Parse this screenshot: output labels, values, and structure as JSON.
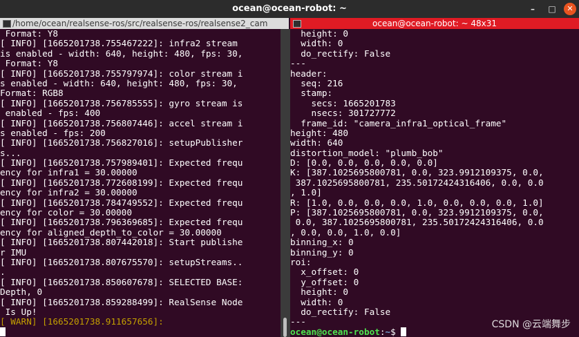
{
  "window": {
    "title": "ocean@ocean-robot: ~",
    "minimize": "–",
    "maximize": "□",
    "close": "✕"
  },
  "tabs": [
    {
      "title": "/home/ocean/realsense-ros/src/realsense-ros/realsense2_cam"
    },
    {
      "title": "ocean@ocean-robot: ~ 48x31"
    }
  ],
  "left_terminal": {
    "lines": [
      " Format: Y8",
      "[ INFO] [1665201738.755467222]: infra2 stream",
      "is enabled - width: 640, height: 480, fps: 30,",
      " Format: Y8",
      "[ INFO] [1665201738.755797974]: color stream i",
      "s enabled - width: 640, height: 480, fps: 30,",
      "Format: RGB8",
      "[ INFO] [1665201738.756785555]: gyro stream is",
      " enabled - fps: 400",
      "[ INFO] [1665201738.756807446]: accel stream i",
      "s enabled - fps: 200",
      "[ INFO] [1665201738.756827016]: setupPublisher",
      "s...",
      "[ INFO] [1665201738.757989401]: Expected frequ",
      "ency for infra1 = 30.00000",
      "[ INFO] [1665201738.772608199]: Expected frequ",
      "ency for infra2 = 30.00000",
      "[ INFO] [1665201738.784749552]: Expected frequ",
      "ency for color = 30.00000",
      "[ INFO] [1665201738.796369685]: Expected frequ",
      "ency for aligned_depth_to_color = 30.00000",
      "[ INFO] [1665201738.807442018]: Start publishe",
      "r IMU",
      "[ INFO] [1665201738.807675570]: setupStreams..",
      ".",
      "[ INFO] [1665201738.850607678]: SELECTED BASE:",
      "Depth, 0",
      "[ INFO] [1665201738.859288499]: RealSense Node",
      " Is Up!"
    ],
    "warn_line": "[ WARN] [1665201738.911657656]:"
  },
  "right_terminal": {
    "lines": [
      "  height: 0",
      "  width: 0",
      "  do_rectify: False",
      "---",
      "header:",
      "  seq: 216",
      "  stamp:",
      "    secs: 1665201783",
      "    nsecs: 301727772",
      "  frame_id: \"camera_infra1_optical_frame\"",
      "height: 480",
      "width: 640",
      "distortion_model: \"plumb_bob\"",
      "D: [0.0, 0.0, 0.0, 0.0, 0.0]",
      "K: [387.1025695800781, 0.0, 323.9912109375, 0.0,",
      " 387.1025695800781, 235.50172424316406, 0.0, 0.0",
      ", 1.0]",
      "R: [1.0, 0.0, 0.0, 0.0, 1.0, 0.0, 0.0, 0.0, 1.0]",
      "P: [387.1025695800781, 0.0, 323.9912109375, 0.0,",
      " 0.0, 387.1025695800781, 235.50172424316406, 0.0",
      ", 0.0, 0.0, 1.0, 0.0]",
      "binning_x: 0",
      "binning_y: 0",
      "roi:",
      "  x_offset: 0",
      "  y_offset: 0",
      "  height: 0",
      "  width: 0",
      "  do_rectify: False",
      "---"
    ],
    "prompt_user": "ocean@ocean-robot",
    "prompt_sep": ":",
    "prompt_path": "~",
    "prompt_symbol": "$ "
  },
  "watermark": "CSDN @云端舞步"
}
